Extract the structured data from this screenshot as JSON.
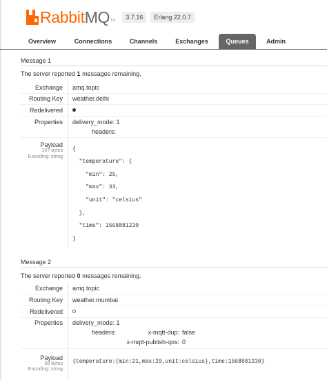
{
  "logo": {
    "prefix": "Rabbit",
    "suffix": "MQ",
    "tm": "TM",
    "brand_color": "#ff6600"
  },
  "versions": [
    "3.7.16",
    "Erlang 22.0.7"
  ],
  "nav": {
    "tabs": [
      "Overview",
      "Connections",
      "Channels",
      "Exchanges",
      "Queues",
      "Admin"
    ],
    "active": "Queues"
  },
  "messages": [
    {
      "title": "Message 1",
      "summary_pre": "The server reported ",
      "summary_count": "1",
      "summary_post": " messages remaining.",
      "labels": {
        "exchange": "Exchange",
        "routing_key": "Routing Key",
        "redelivered": "Redelivered",
        "properties": "Properties",
        "payload": "Payload"
      },
      "exchange": "amq.topic",
      "routing_key": "weather.delhi",
      "redelivered": true,
      "properties": {
        "delivery_mode_key": "delivery_mode:",
        "delivery_mode_val": "1",
        "headers_key": "headers:"
      },
      "payload_size": "107 bytes",
      "payload_encoding": "Encoding: string",
      "payload_lines": [
        "{",
        "  \"temperature\": {",
        "    \"min\": 25,",
        "    \"max\": 33,",
        "    \"unit\": \"celsius\"",
        "  },",
        "  \"time\": 1568881230",
        "}"
      ]
    },
    {
      "title": "Message 2",
      "summary_pre": "The server reported ",
      "summary_count": "0",
      "summary_post": " messages remaining.",
      "labels": {
        "exchange": "Exchange",
        "routing_key": "Routing Key",
        "redelivered": "Redelivered",
        "properties": "Properties",
        "payload": "Payload"
      },
      "exchange": "amq.topic",
      "routing_key": "weather.mumbai",
      "redelivered": false,
      "properties": {
        "delivery_mode_key": "delivery_mode:",
        "delivery_mode_val": "1",
        "headers_key": "headers:",
        "dup_key": "x-mqtt-dup:",
        "dup_val": "false",
        "qos_key": "x-mqtt-publish-qos:",
        "qos_val": "0"
      },
      "payload_size": "58 bytes",
      "payload_encoding": "Encoding: string",
      "payload_text": "{temperature:{min:21,max:29,unit:celsius},time:1568881230}"
    }
  ]
}
